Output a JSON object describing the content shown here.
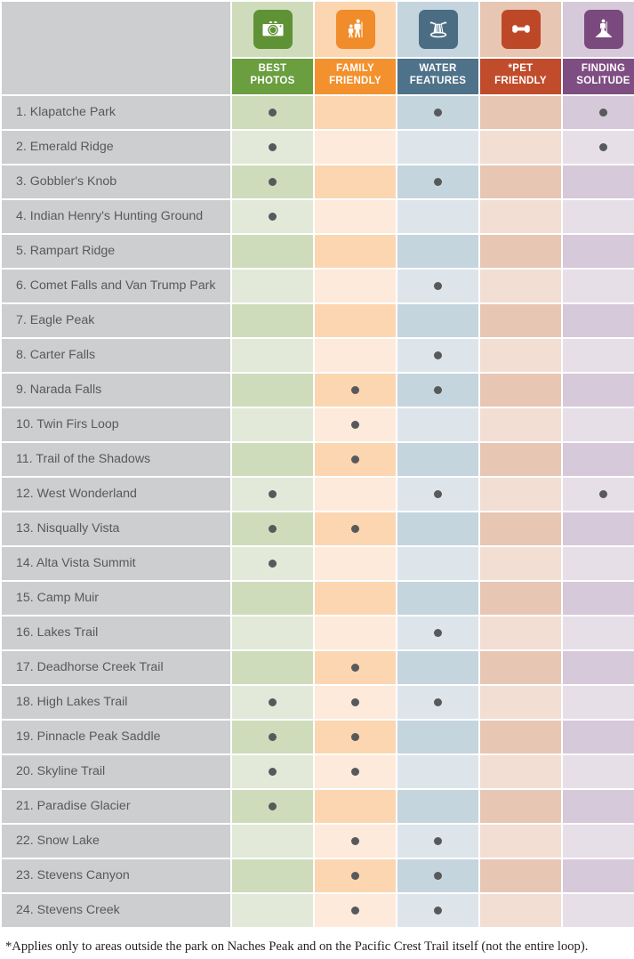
{
  "columns": [
    {
      "key": "best_photos",
      "label_line1": "BEST",
      "label_line2": "PHOTOS",
      "icon": "camera-icon",
      "band": "#6a9e3f",
      "badge": "#5f9235",
      "tint_dark": "#cfdcbb",
      "tint_light": "#e2e9d8"
    },
    {
      "key": "family_friendly",
      "label_line1": "FAMILY",
      "label_line2": "FRIENDLY",
      "icon": "family-hikers-icon",
      "band": "#f3912e",
      "badge": "#f08c2a",
      "tint_dark": "#fbd6b1",
      "tint_light": "#fdeada"
    },
    {
      "key": "water_features",
      "label_line1": "WATER",
      "label_line2": "FEATURES",
      "icon": "waterfall-icon",
      "band": "#4e7289",
      "badge": "#4a6d84",
      "tint_dark": "#c5d5de",
      "tint_light": "#dde5ea"
    },
    {
      "key": "pet_friendly",
      "label_line1": "*PET",
      "label_line2": "FRIENDLY",
      "icon": "dog-bone-icon",
      "band": "#c04c2c",
      "badge": "#bd4828",
      "tint_dark": "#e8c6b4",
      "tint_light": "#f2ded3"
    },
    {
      "key": "finding_solitude",
      "label_line1": "FINDING",
      "label_line2": "SOLITUDE",
      "icon": "hiker-summit-icon",
      "band": "#7e4d82",
      "badge": "#7a4a7e",
      "tint_dark": "#d6c9d9",
      "tint_light": "#e6dfe8"
    }
  ],
  "rows": [
    {
      "label": "1. Klapatche Park",
      "marks": [
        1,
        0,
        1,
        0,
        1
      ]
    },
    {
      "label": "2. Emerald Ridge",
      "marks": [
        1,
        0,
        0,
        0,
        1
      ]
    },
    {
      "label": "3. Gobbler's Knob",
      "marks": [
        1,
        0,
        1,
        0,
        0
      ]
    },
    {
      "label": "4. Indian Henry's Hunting Ground",
      "marks": [
        1,
        0,
        0,
        0,
        0
      ]
    },
    {
      "label": "5. Rampart Ridge",
      "marks": [
        0,
        0,
        0,
        0,
        0
      ]
    },
    {
      "label": "6. Comet Falls and Van Trump Park",
      "marks": [
        0,
        0,
        1,
        0,
        0
      ]
    },
    {
      "label": "7. Eagle Peak",
      "marks": [
        0,
        0,
        0,
        0,
        0
      ]
    },
    {
      "label": "8. Carter Falls",
      "marks": [
        0,
        0,
        1,
        0,
        0
      ]
    },
    {
      "label": "9. Narada Falls",
      "marks": [
        0,
        1,
        1,
        0,
        0
      ]
    },
    {
      "label": "10. Twin Firs Loop",
      "marks": [
        0,
        1,
        0,
        0,
        0
      ]
    },
    {
      "label": "11. Trail of the Shadows",
      "marks": [
        0,
        1,
        0,
        0,
        0
      ]
    },
    {
      "label": "12. West Wonderland",
      "marks": [
        1,
        0,
        1,
        0,
        1
      ]
    },
    {
      "label": "13. Nisqually Vista",
      "marks": [
        1,
        1,
        0,
        0,
        0
      ]
    },
    {
      "label": "14. Alta Vista Summit",
      "marks": [
        1,
        0,
        0,
        0,
        0
      ]
    },
    {
      "label": "15. Camp Muir",
      "marks": [
        0,
        0,
        0,
        0,
        0
      ]
    },
    {
      "label": "16. Lakes Trail",
      "marks": [
        0,
        0,
        1,
        0,
        0
      ]
    },
    {
      "label": "17. Deadhorse Creek Trail",
      "marks": [
        0,
        1,
        0,
        0,
        0
      ]
    },
    {
      "label": "18. High Lakes Trail",
      "marks": [
        1,
        1,
        1,
        0,
        0
      ]
    },
    {
      "label": "19. Pinnacle Peak Saddle",
      "marks": [
        1,
        1,
        0,
        0,
        0
      ]
    },
    {
      "label": "20. Skyline Trail",
      "marks": [
        1,
        1,
        0,
        0,
        0
      ]
    },
    {
      "label": "21. Paradise Glacier",
      "marks": [
        1,
        0,
        0,
        0,
        0
      ]
    },
    {
      "label": "22. Snow Lake",
      "marks": [
        0,
        1,
        1,
        0,
        0
      ]
    },
    {
      "label": "23. Stevens Canyon",
      "marks": [
        0,
        1,
        1,
        0,
        0
      ]
    },
    {
      "label": "24. Stevens Creek",
      "marks": [
        0,
        1,
        1,
        0,
        0
      ]
    }
  ],
  "footnote": "*Applies only to areas outside the park on Naches Peak and on the Pacific Crest Trail itself (not the entire loop).",
  "colors": {
    "label_bg": "#cdced0",
    "text": "#58595b",
    "dot": "#58595b",
    "page_bg": "#ffffff"
  }
}
